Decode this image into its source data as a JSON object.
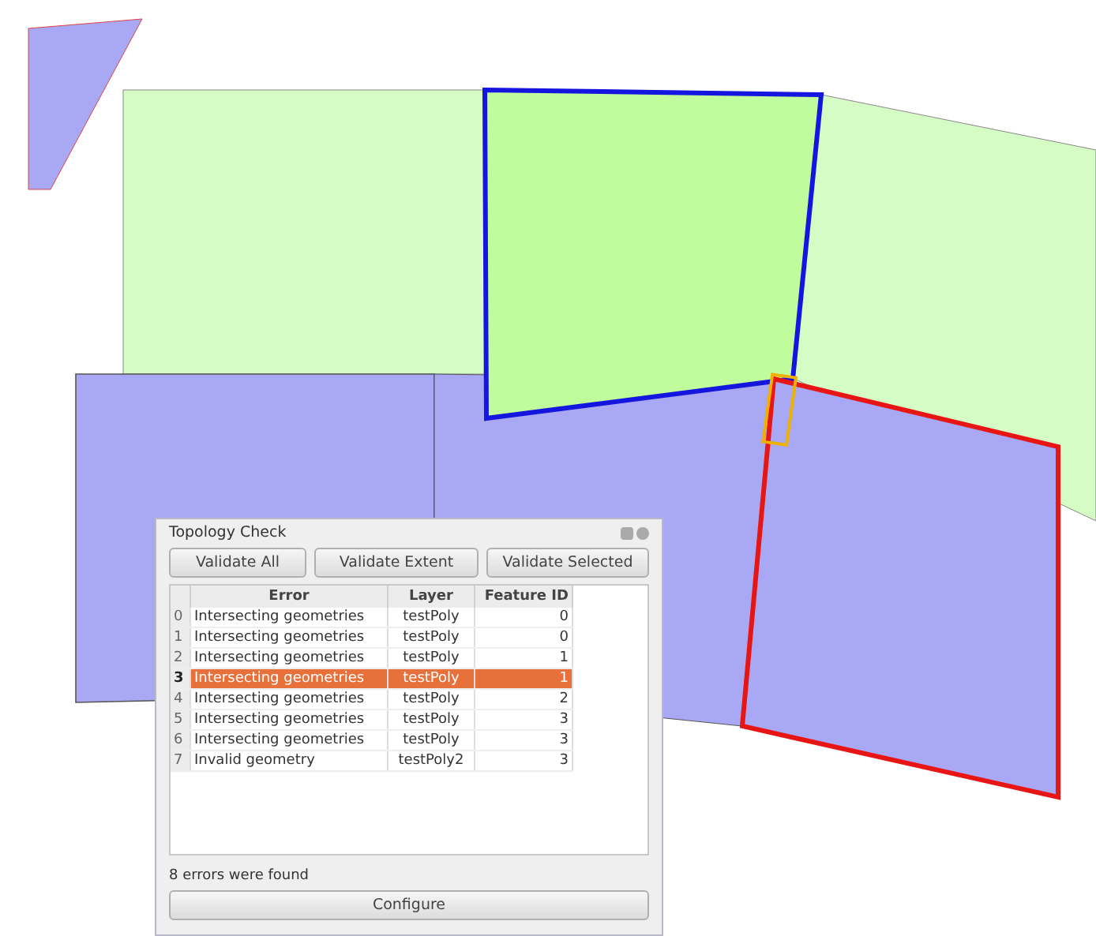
{
  "dialog": {
    "title": "Topology Check",
    "buttons": [
      "Validate All",
      "Validate Extent",
      "Validate Selected"
    ],
    "table": {
      "columns": [
        "Error",
        "Layer",
        "Feature ID"
      ],
      "rows": [
        {
          "index": "0",
          "error": "Intersecting geometries",
          "layer": "testPoly",
          "feature_id": "0",
          "selected": false
        },
        {
          "index": "1",
          "error": "Intersecting geometries",
          "layer": "testPoly",
          "feature_id": "0",
          "selected": false
        },
        {
          "index": "2",
          "error": "Intersecting geometries",
          "layer": "testPoly",
          "feature_id": "1",
          "selected": false
        },
        {
          "index": "3",
          "error": "Intersecting geometries",
          "layer": "testPoly",
          "feature_id": "1",
          "selected": true
        },
        {
          "index": "4",
          "error": "Intersecting geometries",
          "layer": "testPoly",
          "feature_id": "2",
          "selected": false
        },
        {
          "index": "5",
          "error": "Intersecting geometries",
          "layer": "testPoly",
          "feature_id": "3",
          "selected": false
        },
        {
          "index": "6",
          "error": "Intersecting geometries",
          "layer": "testPoly",
          "feature_id": "3",
          "selected": false
        },
        {
          "index": "7",
          "error": "Invalid geometry",
          "layer": "testPoly2",
          "feature_id": "3",
          "selected": false
        }
      ]
    },
    "status": "8 errors were found",
    "configure_button": "Configure"
  }
}
